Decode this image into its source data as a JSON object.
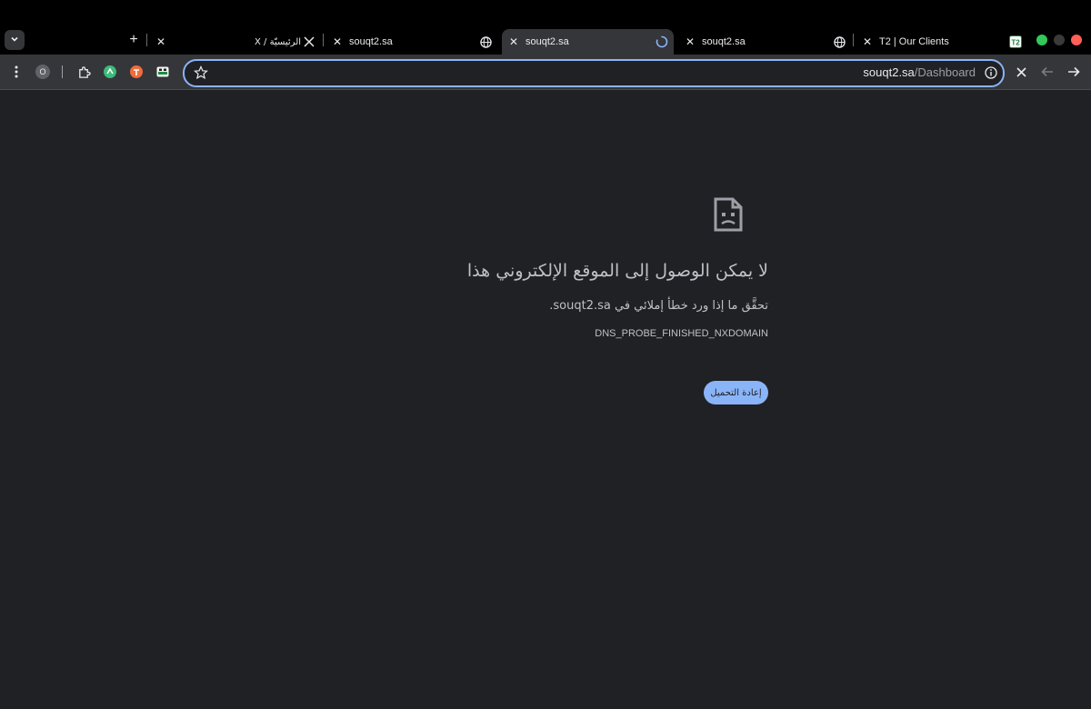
{
  "window": {
    "traffic_lights": [
      "#34c759",
      "#3a3a3c",
      "#ff5f57"
    ]
  },
  "tabs": [
    {
      "title": "T2 | Our Clients",
      "favicon": "t2-logo-icon",
      "active": false
    },
    {
      "title": "souqt2.sa",
      "favicon": "globe-icon",
      "active": false
    },
    {
      "title": "souqt2.sa",
      "favicon": "loading-spinner-icon",
      "active": true
    },
    {
      "title": "souqt2.sa",
      "favicon": "globe-icon",
      "active": false
    },
    {
      "title": "الرئيسيّة / X",
      "favicon": "x-logo-icon",
      "active": false
    }
  ],
  "toolbar": {
    "url_host": "souqt2.sa",
    "url_path": "/Dashboard",
    "extensions": [
      "profile-badge",
      "puzzle-extensions-icon",
      "green-extension-icon",
      "orange-extension-icon",
      "bookmark-extension-icon"
    ],
    "profile_letter": "O"
  },
  "error": {
    "title": "لا يمكن الوصول إلى الموقع الإلكتروني هذا",
    "subtitle": "تحقَّق ما إذا ورد خطأ إملائي في souqt2.sa.",
    "code": "DNS_PROBE_FINISHED_NXDOMAIN",
    "reload_label": "إعادة التحميل"
  },
  "colors": {
    "accent": "#8ab4f8",
    "background": "#202124",
    "toolbar": "#35363a"
  }
}
